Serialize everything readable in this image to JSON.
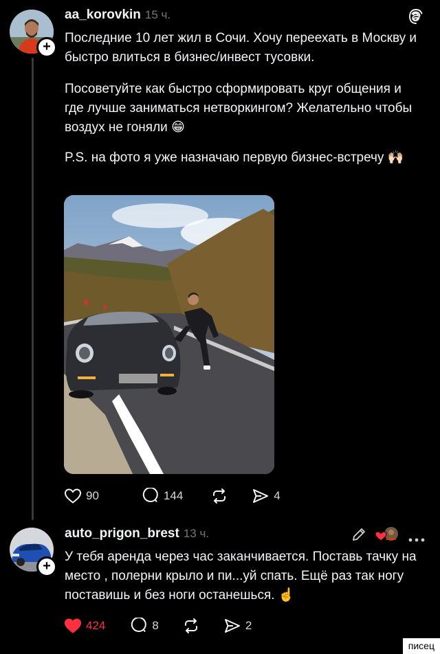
{
  "post": {
    "username": "aa_korovkin",
    "time": "15 ч.",
    "paragraphs": [
      "Последние 10 лет жил в Сочи. Хочу переехать в Москву и быстро влиться в бизнес/инвест тусовки.",
      "Посоветуйте как быстро сформировать круг общения и где лучше заниматься нетворкингом? Желательно чтобы воздух не гоняли 😁",
      "P.S. на фото я уже назначаю первую бизнес-встречу 🙌🏻"
    ],
    "likes": "90",
    "comments": "144",
    "shares": "4"
  },
  "reply": {
    "username": "auto_prigon_brest",
    "time": "13 ч.",
    "text": "У тебя аренда через час заканчивается. Поставь тачку на место , полерни крыло и пи...уй спать. Ещё раз так ногу поставишь и без ноги останешься. ☝️",
    "likes": "424",
    "comments": "8",
    "shares": "2"
  },
  "colors": {
    "like_active": "#ff3040",
    "background": "#000000",
    "text": "#f3f5f7",
    "muted": "#777777"
  },
  "icons": {
    "app": "threads-logo-icon",
    "plus": "follow-plus-icon",
    "heart": "heart-icon",
    "comment": "comment-icon",
    "repost": "repost-icon",
    "share": "send-icon",
    "edit": "pencil-icon",
    "more": "more-dots-icon"
  },
  "watermark": "писец"
}
